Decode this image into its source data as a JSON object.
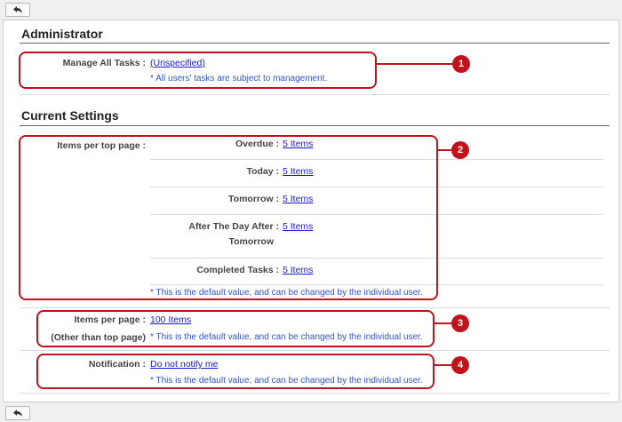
{
  "administrator": {
    "title": "Administrator",
    "manage_all_tasks_label": "Manage All Tasks :",
    "manage_all_tasks_value": "(Unspecified)",
    "manage_all_tasks_note": "* All users' tasks are subject to management."
  },
  "current_settings": {
    "title": "Current Settings",
    "items_per_top_page_label": "Items per top page :",
    "rows": [
      {
        "label": "Overdue :",
        "value": "5 Items"
      },
      {
        "label": "Today :",
        "value": "5 Items"
      },
      {
        "label": "Tomorrow :",
        "value": "5 Items"
      },
      {
        "label": "After The Day After :",
        "label2": "Tomorrow",
        "value": "5 Items"
      },
      {
        "label": "Completed Tasks :",
        "value": "5 Items"
      }
    ],
    "top_page_note": "* This is the default value, and can be changed by the individual user.",
    "items_per_page_label": "Items per page :",
    "items_per_page_label2": "(Other than top page)",
    "items_per_page_value": "100 Items",
    "items_per_page_note": "* This is the default value, and can be changed by the individual user.",
    "notification_label": "Notification :",
    "notification_value": "Do not notify me",
    "notification_note": "* This is the default value, and can be changed by the individual user."
  },
  "callouts": [
    "1",
    "2",
    "3",
    "4"
  ],
  "colors": {
    "callout": "#c0141d",
    "link": "#1a1acc",
    "note": "#3355cc"
  }
}
